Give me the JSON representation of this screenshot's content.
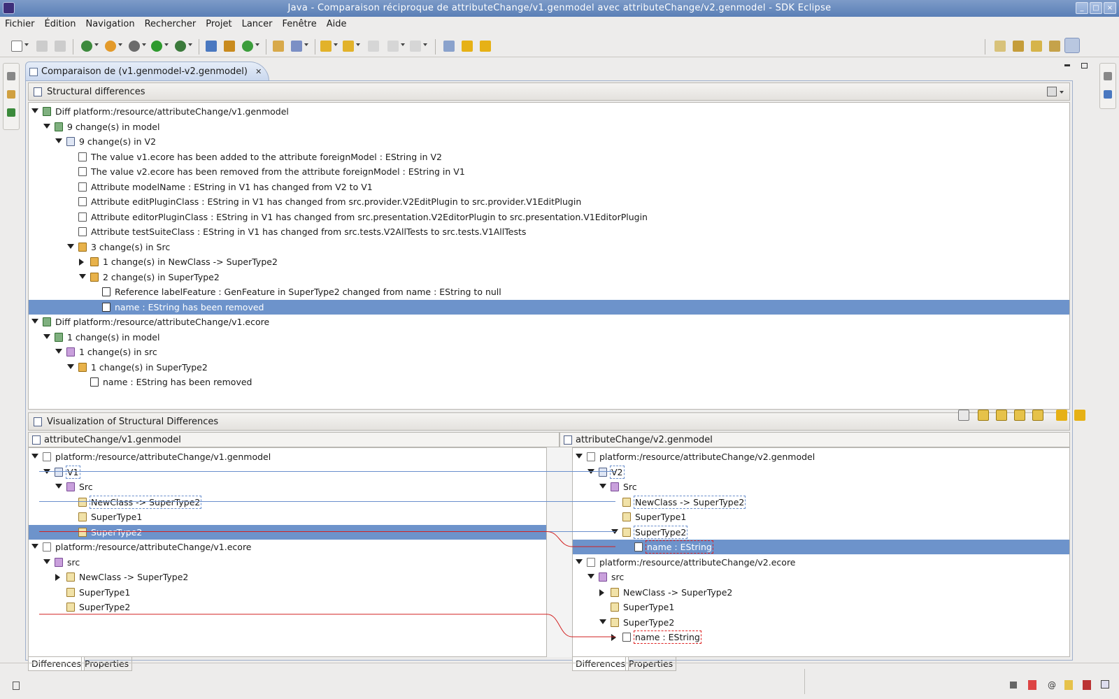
{
  "window": {
    "title": "Java - Comparaison réciproque de attributeChange/v1.genmodel avec attributeChange/v2.genmodel - SDK Eclipse"
  },
  "menu": [
    "Fichier",
    "Édition",
    "Navigation",
    "Rechercher",
    "Projet",
    "Lancer",
    "Fenêtre",
    "Aide"
  ],
  "editor": {
    "tab_label": "Comparaison de (v1.genmodel-v2.genmodel)",
    "close": "✕"
  },
  "structural": {
    "title": "Structural differences",
    "rows": [
      {
        "indent": 0,
        "tw": "open",
        "icon": "tree",
        "text": "Diff platform:/resource/attributeChange/v1.genmodel"
      },
      {
        "indent": 1,
        "tw": "open",
        "icon": "tree",
        "text": "9 change(s) in model"
      },
      {
        "indent": 2,
        "tw": "open",
        "icon": "diff",
        "text": "9 change(s) in V2"
      },
      {
        "indent": 3,
        "tw": "",
        "icon": "attr",
        "text": "The value v1.ecore has been added to the attribute foreignModel : EString in V2"
      },
      {
        "indent": 3,
        "tw": "",
        "icon": "attr",
        "text": "The value v2.ecore has been removed from the attribute foreignModel : EString in V1"
      },
      {
        "indent": 3,
        "tw": "",
        "icon": "attr",
        "text": "Attribute modelName : EString in V1 has changed from V2 to V1"
      },
      {
        "indent": 3,
        "tw": "",
        "icon": "attr",
        "text": "Attribute editPluginClass : EString in V1 has changed from src.provider.V2EditPlugin to src.provider.V1EditPlugin"
      },
      {
        "indent": 3,
        "tw": "",
        "icon": "attr",
        "text": "Attribute editorPluginClass : EString in V1 has changed from src.presentation.V2EditorPlugin to src.presentation.V1EditorPlugin"
      },
      {
        "indent": 3,
        "tw": "",
        "icon": "attr",
        "text": "Attribute testSuiteClass : EString in V1 has changed from src.tests.V2AllTests to src.tests.V1AllTests"
      },
      {
        "indent": 3,
        "tw": "open",
        "icon": "pk",
        "text": "3 change(s) in Src"
      },
      {
        "indent": 4,
        "tw": "closed",
        "icon": "pk",
        "text": "1 change(s) in NewClass -> SuperType2"
      },
      {
        "indent": 4,
        "tw": "open",
        "icon": "pk",
        "text": "2 change(s) in SuperType2"
      },
      {
        "indent": 5,
        "tw": "",
        "icon": "ref",
        "text": "Reference labelFeature : GenFeature in SuperType2 changed from name : EString to null"
      },
      {
        "indent": 5,
        "tw": "",
        "icon": "ref",
        "text": "name : EString has been removed",
        "selected": true
      },
      {
        "indent": 0,
        "tw": "open",
        "icon": "tree",
        "text": "Diff platform:/resource/attributeChange/v1.ecore"
      },
      {
        "indent": 1,
        "tw": "open",
        "icon": "tree",
        "text": "1 change(s) in model"
      },
      {
        "indent": 2,
        "tw": "open",
        "icon": "pkg",
        "text": "1 change(s) in src"
      },
      {
        "indent": 3,
        "tw": "open",
        "icon": "pk",
        "text": "1 change(s) in SuperType2"
      },
      {
        "indent": 4,
        "tw": "",
        "icon": "ref",
        "text": "name : EString has been removed"
      }
    ]
  },
  "viz": {
    "title": "Visualization of Structural Differences",
    "left": {
      "header": "attributeChange/v1.genmodel",
      "rows": [
        {
          "x": 0,
          "tw": "open",
          "icon": "doc",
          "text": "platform:/resource/attributeChange/v1.genmodel"
        },
        {
          "x": 1,
          "tw": "open",
          "icon": "diff",
          "text": "V1",
          "box": "blue"
        },
        {
          "x": 2,
          "tw": "open",
          "icon": "pkg",
          "text": "Src"
        },
        {
          "x": 3,
          "tw": "",
          "icon": "cls",
          "text": "NewClass -> SuperType2",
          "box": "blue"
        },
        {
          "x": 3,
          "tw": "",
          "icon": "cls",
          "text": "SuperType1"
        },
        {
          "x": 3,
          "tw": "",
          "icon": "cls",
          "text": "SuperType2",
          "selected": true
        },
        {
          "x": 0,
          "tw": "open",
          "icon": "doc",
          "text": "platform:/resource/attributeChange/v1.ecore"
        },
        {
          "x": 1,
          "tw": "open",
          "icon": "pkg",
          "text": "src"
        },
        {
          "x": 2,
          "tw": "closed",
          "icon": "cls",
          "text": "NewClass -> SuperType2"
        },
        {
          "x": 2,
          "tw": "",
          "icon": "cls",
          "text": "SuperType1"
        },
        {
          "x": 2,
          "tw": "",
          "icon": "cls",
          "text": "SuperType2"
        }
      ]
    },
    "right": {
      "header": "attributeChange/v2.genmodel",
      "rows": [
        {
          "x": 0,
          "tw": "open",
          "icon": "doc",
          "text": "platform:/resource/attributeChange/v2.genmodel"
        },
        {
          "x": 1,
          "tw": "open",
          "icon": "diff",
          "text": "V2",
          "box": "blue"
        },
        {
          "x": 2,
          "tw": "open",
          "icon": "pkg",
          "text": "Src"
        },
        {
          "x": 3,
          "tw": "",
          "icon": "cls",
          "text": "NewClass -> SuperType2",
          "box": "blue"
        },
        {
          "x": 3,
          "tw": "",
          "icon": "cls",
          "text": "SuperType1"
        },
        {
          "x": 3,
          "tw": "open",
          "icon": "cls",
          "text": "SuperType2",
          "box": "blue"
        },
        {
          "x": 4,
          "tw": "",
          "icon": "attr",
          "text": "name : EString",
          "selected": true,
          "box": "red"
        },
        {
          "x": 0,
          "tw": "open",
          "icon": "doc",
          "text": "platform:/resource/attributeChange/v2.ecore"
        },
        {
          "x": 1,
          "tw": "open",
          "icon": "pkg",
          "text": "src"
        },
        {
          "x": 2,
          "tw": "closed",
          "icon": "cls",
          "text": "NewClass -> SuperType2"
        },
        {
          "x": 2,
          "tw": "",
          "icon": "cls",
          "text": "SuperType1"
        },
        {
          "x": 2,
          "tw": "open",
          "icon": "cls",
          "text": "SuperType2"
        },
        {
          "x": 3,
          "tw": "closed",
          "icon": "attr",
          "text": "name : EString",
          "box": "red"
        }
      ]
    },
    "tabs": [
      "Differences",
      "Properties"
    ]
  },
  "colors": {
    "selection": "#6d93cb",
    "diff_line": "#d22222",
    "match_line": "#6a8fcc"
  }
}
